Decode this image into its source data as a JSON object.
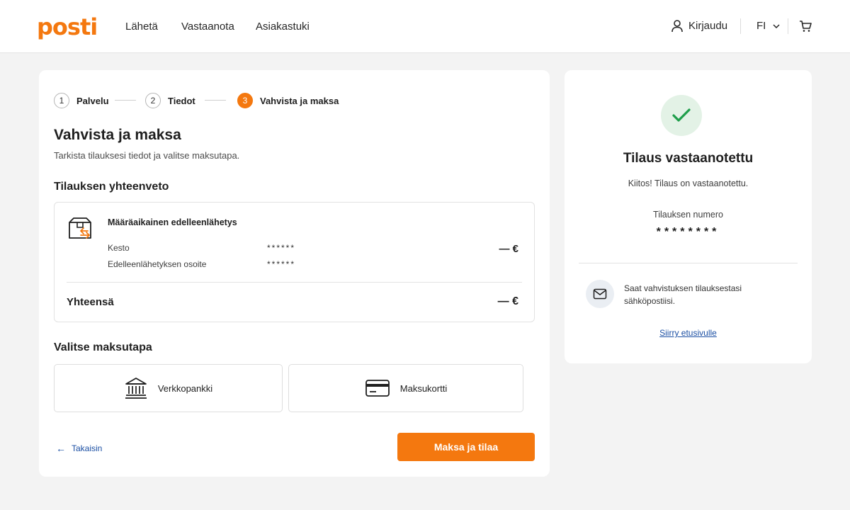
{
  "header": {
    "logo": "posti",
    "nav": [
      "Lähetä",
      "Vastaanota",
      "Asiakastuki"
    ],
    "login": "Kirjaudu",
    "language": "FI",
    "icons": [
      "user-icon",
      "chevron-down-icon",
      "cart-icon"
    ]
  },
  "stepper": {
    "steps": [
      {
        "num": "1",
        "label": "Palvelu"
      },
      {
        "num": "2",
        "label": "Tiedot"
      },
      {
        "num": "3",
        "label": "Vahvista ja maksa"
      }
    ],
    "active_color": "#f4780f"
  },
  "main": {
    "title": "Vahvista ja maksa",
    "subtitle": "Tarkista tilauksesi tiedot ja valitse maksutapa.",
    "summary_heading": "Tilauksen yhteenveto",
    "product": {
      "icon": "package-forward-icon",
      "name": "Määräaikainen edelleenlähetys",
      "rows": [
        {
          "label": "Kesto",
          "value": "******"
        },
        {
          "label": "Edelleenlähetyksen osoite",
          "value": "******"
        }
      ],
      "price": "— €"
    },
    "total_label": "Yhteensä",
    "total_value": "— €",
    "payment_heading": "Valitse maksutapa",
    "payment_options": [
      {
        "icon": "bank-icon",
        "label": "Verkkopankki"
      },
      {
        "icon": "credit-card-icon",
        "label": "Maksukortti"
      }
    ],
    "back_label": "Takaisin",
    "pay_button": "Maksa ja tilaa"
  },
  "confirmation": {
    "icon": "check-icon",
    "title": "Tilaus vastaanotettu",
    "message": "Kiitos! Tilaus on vastaanotettu.",
    "order_number_label": "Tilauksen numero",
    "order_number": "********",
    "email_icon": "mail-icon",
    "email_note": "Saat vahvistuksen tilauksestasi sähköpostiisi.",
    "home_link": "Siirry etusivulle"
  },
  "colors": {
    "brand": "#f4780f",
    "success": "#1e9e4a",
    "link": "#1b4fa3",
    "page_bg": "#f3f3f3"
  }
}
